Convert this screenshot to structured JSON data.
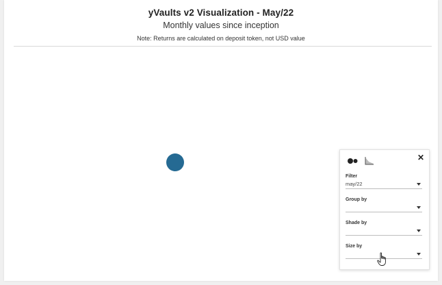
{
  "header": {
    "title": "yVaults v2 Visualization - May/22",
    "subtitle": "Monthly values since inception",
    "note": "Note: Returns are calculated on deposit token, not USD value"
  },
  "colors": {
    "bubble": "#256a93",
    "background": "#ffffff"
  },
  "chart_data": {
    "type": "scatter",
    "series": [
      {
        "values": [
          1
        ]
      }
    ]
  },
  "controls": {
    "icons": [
      "bubbles-mode-icon",
      "area-mode-icon",
      "close-icon"
    ],
    "filter": {
      "label": "Filter",
      "value": "may/22"
    },
    "group_by": {
      "label": "Group by",
      "value": ""
    },
    "shade_by": {
      "label": "Shade by",
      "value": ""
    },
    "size_by": {
      "label": "Size by",
      "value": ""
    }
  }
}
